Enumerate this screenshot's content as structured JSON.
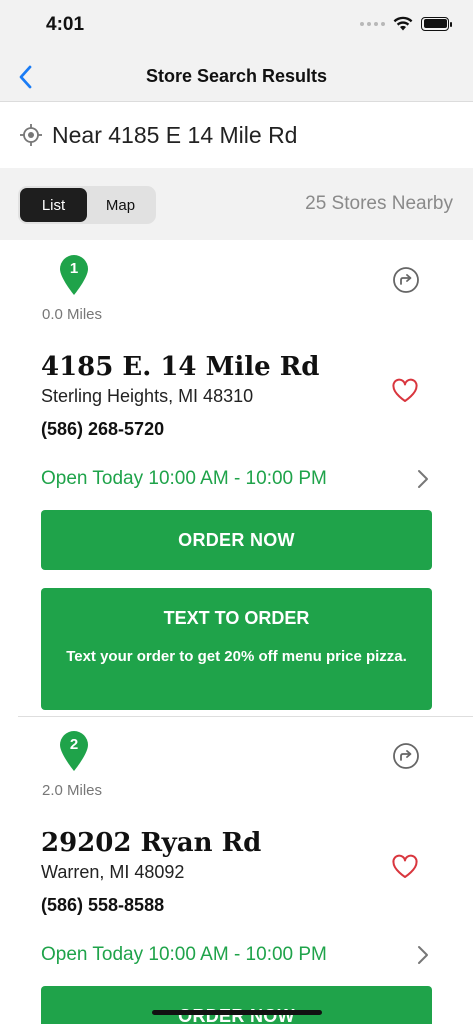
{
  "status_bar": {
    "time": "4:01"
  },
  "nav": {
    "title": "Store Search Results"
  },
  "search": {
    "text": "Near 4185 E 14 Mile Rd"
  },
  "view_toggle": {
    "list_label": "List",
    "map_label": "Map",
    "selected": "List"
  },
  "stores_count": "25 Stores Nearby",
  "colors": {
    "accent_green": "#1fa34a",
    "ios_blue": "#1a7cf5",
    "heart_red": "#d9363e"
  },
  "stores": [
    {
      "number": "1",
      "distance": "0.0 Miles",
      "name": "4185 E. 14 Mile Rd",
      "city": "Sterling Heights, MI 48310",
      "phone": "(586) 268-5720",
      "hours": "Open Today 10:00 AM - 10:00 PM",
      "order_label": "ORDER NOW",
      "text_order_title": "TEXT TO ORDER",
      "text_order_desc": "Text your order to get 20% off menu price pizza."
    },
    {
      "number": "2",
      "distance": "2.0 Miles",
      "name": "29202 Ryan Rd",
      "city": "Warren, MI 48092",
      "phone": "(586) 558-8588",
      "hours": "Open Today 10:00 AM - 10:00 PM",
      "order_label": "ORDER NOW"
    }
  ]
}
